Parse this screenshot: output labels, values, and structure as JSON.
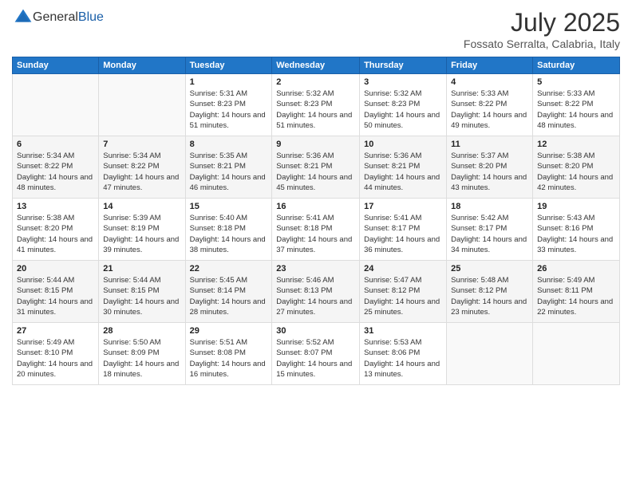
{
  "logo": {
    "general": "General",
    "blue": "Blue"
  },
  "title": {
    "month_year": "July 2025",
    "location": "Fossato Serralta, Calabria, Italy"
  },
  "days_of_week": [
    "Sunday",
    "Monday",
    "Tuesday",
    "Wednesday",
    "Thursday",
    "Friday",
    "Saturday"
  ],
  "weeks": [
    [
      {
        "day": "",
        "info": ""
      },
      {
        "day": "",
        "info": ""
      },
      {
        "day": "1",
        "info": "Sunrise: 5:31 AM\nSunset: 8:23 PM\nDaylight: 14 hours and 51 minutes."
      },
      {
        "day": "2",
        "info": "Sunrise: 5:32 AM\nSunset: 8:23 PM\nDaylight: 14 hours and 51 minutes."
      },
      {
        "day": "3",
        "info": "Sunrise: 5:32 AM\nSunset: 8:23 PM\nDaylight: 14 hours and 50 minutes."
      },
      {
        "day": "4",
        "info": "Sunrise: 5:33 AM\nSunset: 8:22 PM\nDaylight: 14 hours and 49 minutes."
      },
      {
        "day": "5",
        "info": "Sunrise: 5:33 AM\nSunset: 8:22 PM\nDaylight: 14 hours and 48 minutes."
      }
    ],
    [
      {
        "day": "6",
        "info": "Sunrise: 5:34 AM\nSunset: 8:22 PM\nDaylight: 14 hours and 48 minutes."
      },
      {
        "day": "7",
        "info": "Sunrise: 5:34 AM\nSunset: 8:22 PM\nDaylight: 14 hours and 47 minutes."
      },
      {
        "day": "8",
        "info": "Sunrise: 5:35 AM\nSunset: 8:21 PM\nDaylight: 14 hours and 46 minutes."
      },
      {
        "day": "9",
        "info": "Sunrise: 5:36 AM\nSunset: 8:21 PM\nDaylight: 14 hours and 45 minutes."
      },
      {
        "day": "10",
        "info": "Sunrise: 5:36 AM\nSunset: 8:21 PM\nDaylight: 14 hours and 44 minutes."
      },
      {
        "day": "11",
        "info": "Sunrise: 5:37 AM\nSunset: 8:20 PM\nDaylight: 14 hours and 43 minutes."
      },
      {
        "day": "12",
        "info": "Sunrise: 5:38 AM\nSunset: 8:20 PM\nDaylight: 14 hours and 42 minutes."
      }
    ],
    [
      {
        "day": "13",
        "info": "Sunrise: 5:38 AM\nSunset: 8:20 PM\nDaylight: 14 hours and 41 minutes."
      },
      {
        "day": "14",
        "info": "Sunrise: 5:39 AM\nSunset: 8:19 PM\nDaylight: 14 hours and 39 minutes."
      },
      {
        "day": "15",
        "info": "Sunrise: 5:40 AM\nSunset: 8:18 PM\nDaylight: 14 hours and 38 minutes."
      },
      {
        "day": "16",
        "info": "Sunrise: 5:41 AM\nSunset: 8:18 PM\nDaylight: 14 hours and 37 minutes."
      },
      {
        "day": "17",
        "info": "Sunrise: 5:41 AM\nSunset: 8:17 PM\nDaylight: 14 hours and 36 minutes."
      },
      {
        "day": "18",
        "info": "Sunrise: 5:42 AM\nSunset: 8:17 PM\nDaylight: 14 hours and 34 minutes."
      },
      {
        "day": "19",
        "info": "Sunrise: 5:43 AM\nSunset: 8:16 PM\nDaylight: 14 hours and 33 minutes."
      }
    ],
    [
      {
        "day": "20",
        "info": "Sunrise: 5:44 AM\nSunset: 8:15 PM\nDaylight: 14 hours and 31 minutes."
      },
      {
        "day": "21",
        "info": "Sunrise: 5:44 AM\nSunset: 8:15 PM\nDaylight: 14 hours and 30 minutes."
      },
      {
        "day": "22",
        "info": "Sunrise: 5:45 AM\nSunset: 8:14 PM\nDaylight: 14 hours and 28 minutes."
      },
      {
        "day": "23",
        "info": "Sunrise: 5:46 AM\nSunset: 8:13 PM\nDaylight: 14 hours and 27 minutes."
      },
      {
        "day": "24",
        "info": "Sunrise: 5:47 AM\nSunset: 8:12 PM\nDaylight: 14 hours and 25 minutes."
      },
      {
        "day": "25",
        "info": "Sunrise: 5:48 AM\nSunset: 8:12 PM\nDaylight: 14 hours and 23 minutes."
      },
      {
        "day": "26",
        "info": "Sunrise: 5:49 AM\nSunset: 8:11 PM\nDaylight: 14 hours and 22 minutes."
      }
    ],
    [
      {
        "day": "27",
        "info": "Sunrise: 5:49 AM\nSunset: 8:10 PM\nDaylight: 14 hours and 20 minutes."
      },
      {
        "day": "28",
        "info": "Sunrise: 5:50 AM\nSunset: 8:09 PM\nDaylight: 14 hours and 18 minutes."
      },
      {
        "day": "29",
        "info": "Sunrise: 5:51 AM\nSunset: 8:08 PM\nDaylight: 14 hours and 16 minutes."
      },
      {
        "day": "30",
        "info": "Sunrise: 5:52 AM\nSunset: 8:07 PM\nDaylight: 14 hours and 15 minutes."
      },
      {
        "day": "31",
        "info": "Sunrise: 5:53 AM\nSunset: 8:06 PM\nDaylight: 14 hours and 13 minutes."
      },
      {
        "day": "",
        "info": ""
      },
      {
        "day": "",
        "info": ""
      }
    ]
  ]
}
